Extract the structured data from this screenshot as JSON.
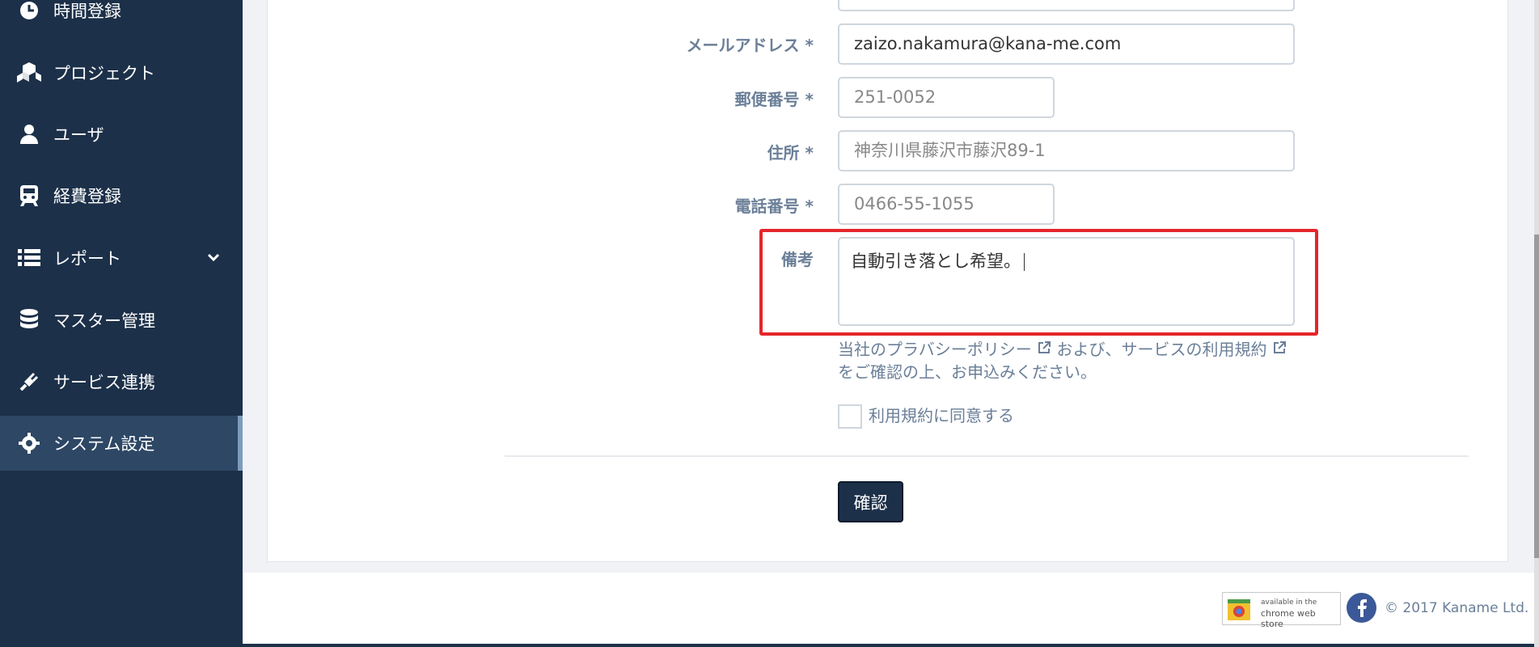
{
  "sidebar": {
    "items": [
      {
        "label": "時間登録",
        "icon": "clock-icon"
      },
      {
        "label": "プロジェクト",
        "icon": "cubes-icon"
      },
      {
        "label": "ユーザ",
        "icon": "user-icon"
      },
      {
        "label": "経費登録",
        "icon": "train-icon"
      },
      {
        "label": "レポート",
        "icon": "list-icon"
      },
      {
        "label": "マスター管理",
        "icon": "database-icon"
      },
      {
        "label": "サービス連携",
        "icon": "plug-icon"
      },
      {
        "label": "システム設定",
        "icon": "gear-icon"
      }
    ]
  },
  "form": {
    "email": {
      "label": "メールアドレス",
      "required": "*",
      "value": "zaizo.nakamura@kana-me.com"
    },
    "postal": {
      "label": "郵便番号",
      "required": "*",
      "placeholder": "251-0052"
    },
    "address": {
      "label": "住所",
      "required": "*",
      "placeholder": "神奈川県藤沢市藤沢89-1"
    },
    "phone": {
      "label": "電話番号",
      "required": "*",
      "placeholder": "0466-55-1055"
    },
    "notes": {
      "label": "備考",
      "value": "自動引き落とし希望。"
    },
    "privacy": {
      "line1_prefix": "当社のプラバシーポリシー",
      "line1_middle": "および、サービスの利用規約",
      "line2": "をご確認の上、お申込みください。"
    },
    "agree_label": "利用規約に同意する",
    "confirm_button": "確認"
  },
  "footer": {
    "chrome_store_small": "available in the",
    "chrome_store_large": "chrome web store",
    "copyright": "© 2017 Kaname Ltd."
  },
  "colors": {
    "sidebar": "#1c3049",
    "highlight": "#e5262b",
    "label": "#6b7f98"
  }
}
